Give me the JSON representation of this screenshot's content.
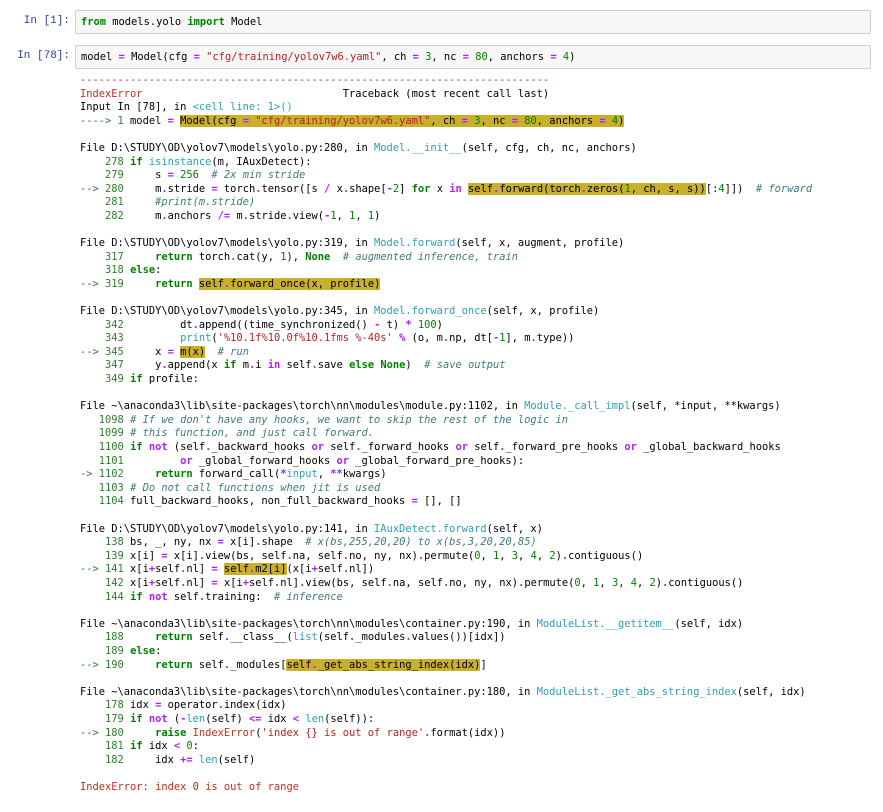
{
  "cells": [
    {
      "prompt": "In [1]:",
      "code": "from models.yolo import Model"
    },
    {
      "prompt": "In [78]:",
      "code": "model = Model(cfg = \"cfg/training/yolov7w6.yaml\", ch = 3, nc = 80, anchors = 4)"
    }
  ],
  "traceback": {
    "dashes": "---------------------------------------------------------------------------",
    "error_name": "IndexError",
    "traceback_label": "Traceback (most recent call last)",
    "input_line": "Input In [78], in ",
    "input_loc": "<cell line: 1>()",
    "final_error": "IndexError: index 0 is out of range"
  }
}
